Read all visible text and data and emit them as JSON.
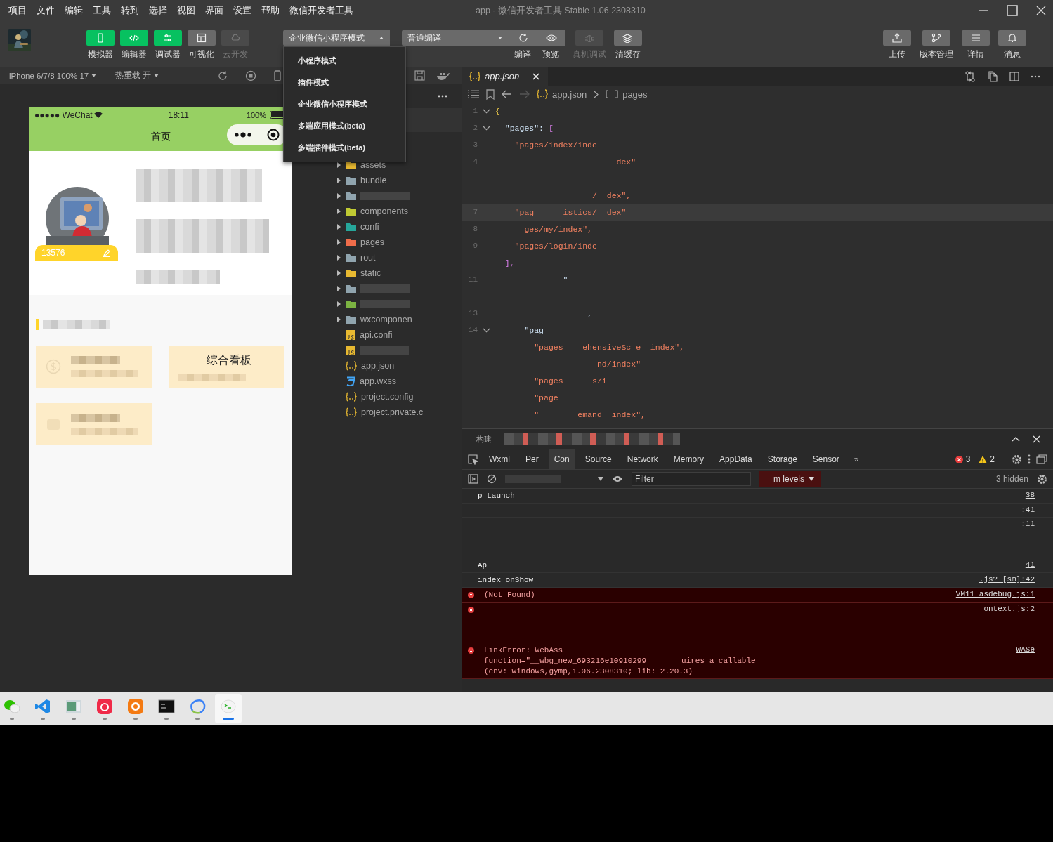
{
  "menu": [
    "项目",
    "文件",
    "编辑",
    "工具",
    "转到",
    "选择",
    "视图",
    "界面",
    "设置",
    "帮助",
    "微信开发者工具"
  ],
  "window": {
    "title": "app - 微信开发者工具 Stable 1.06.2308310"
  },
  "toolbar": {
    "view_buttons": [
      {
        "label": "模拟器",
        "on": true,
        "disabled": false
      },
      {
        "label": "编辑器",
        "on": true,
        "disabled": false
      },
      {
        "label": "调试器",
        "on": true,
        "disabled": false
      },
      {
        "label": "可视化",
        "on": false,
        "disabled": false
      },
      {
        "label": "云开发",
        "on": false,
        "disabled": true
      }
    ],
    "mode_select": {
      "value": "企业微信小程序模式",
      "expanded": true,
      "options": [
        "小程序模式",
        "插件模式",
        "企业微信小程序模式",
        "多端应用模式(beta)",
        "多端插件模式(beta)"
      ]
    },
    "compile_select": {
      "value": "普通编译"
    },
    "compile_buttons": [
      {
        "label": "编译",
        "disabled": false
      },
      {
        "label": "预览",
        "disabled": false
      },
      {
        "label": "真机调试",
        "disabled": true
      },
      {
        "label": "清缓存",
        "disabled": false
      }
    ],
    "right_buttons": [
      {
        "label": "上传"
      },
      {
        "label": "版本管理"
      },
      {
        "label": "详情"
      },
      {
        "label": "消息"
      }
    ]
  },
  "simulator": {
    "device": "iPhone 6/7/8 100% 17",
    "hot_reload": "热重载 开",
    "phone": {
      "carrier": "●●●●● WeChat",
      "time": "18:11",
      "battery": "100%",
      "nav_title": "首页",
      "badge": "13576",
      "cards": [
        {
          "kind": "coin"
        },
        {
          "kind": "board",
          "title": "综合看板"
        },
        {
          "kind": "plain"
        }
      ]
    }
  },
  "file_tree": [
    {
      "kind": "folder",
      "name": "assets",
      "color": "#e8b931",
      "expanded": false
    },
    {
      "kind": "folder",
      "name": "bundle",
      "color": "#90a4ae",
      "expanded": false
    },
    {
      "kind": "folder",
      "color": "#90a4ae",
      "expanded": false
    },
    {
      "kind": "folder",
      "name": "components",
      "color": "#c0ca33",
      "expanded": false
    },
    {
      "kind": "folder",
      "name": "confi",
      "color": "#26a69a",
      "expanded": false
    },
    {
      "kind": "folder",
      "name": "pages",
      "color": "#ef6c4a",
      "expanded": false
    },
    {
      "kind": "folder",
      "name": "rout",
      "color": "#90a4ae",
      "expanded": false
    },
    {
      "kind": "folder",
      "name": "static",
      "color": "#e8b931",
      "expanded": false
    },
    {
      "kind": "folder",
      "color": "#90a4ae",
      "expanded": false
    },
    {
      "kind": "folder",
      "color": "#7cb342",
      "expanded": false
    },
    {
      "kind": "folder",
      "name": "wxcomponen",
      "color": "#90a4ae",
      "expanded": false
    },
    {
      "kind": "js",
      "name": "api.confi"
    },
    {
      "kind": "js"
    },
    {
      "kind": "json",
      "name": "app.json"
    },
    {
      "kind": "css",
      "name": "app.wxss"
    },
    {
      "kind": "json",
      "name": "project.config"
    },
    {
      "kind": "json",
      "name": "project.private.c"
    }
  ],
  "editor": {
    "tab": {
      "label": "app.json"
    },
    "breadcrumb": [
      "app.json",
      "pages"
    ],
    "lines": [
      {
        "num": "1",
        "fold": true,
        "current": false,
        "segs": [
          {
            "t": "{",
            "kind": "brace"
          }
        ]
      },
      {
        "num": "2",
        "fold": true,
        "current": false,
        "segs": [
          {
            "t": "  \"pages\": ",
            "kind": "key"
          },
          {
            "t": "[",
            "kind": "bracket"
          }
        ]
      },
      {
        "num": "3",
        "fold": false,
        "current": false,
        "segs": [
          {
            "t": "    \"pages/index/inde",
            "kind": "str"
          }
        ]
      },
      {
        "num": "4",
        "fold": false,
        "current": false,
        "segs": [
          {
            "t": "                         dex\"",
            "kind": "str"
          }
        ]
      },
      {
        "fold": false,
        "current": false
      },
      {
        "fold": false,
        "current": false,
        "segs": [
          {
            "t": "                    /  dex\",",
            "kind": "str"
          }
        ]
      },
      {
        "num": "7",
        "fold": false,
        "current": true,
        "segs": [
          {
            "t": "    \"pag      istics/  dex\"",
            "kind": "str"
          }
        ]
      },
      {
        "num": "8",
        "fold": false,
        "current": false,
        "segs": [
          {
            "t": "      ges/my/index\",",
            "kind": "str"
          }
        ]
      },
      {
        "num": "9",
        "fold": false,
        "current": false,
        "segs": [
          {
            "t": "    \"pages/login/inde",
            "kind": "str"
          }
        ]
      },
      {
        "fold": false,
        "current": false,
        "segs": [
          {
            "t": "  ],",
            "kind": "bracket"
          }
        ]
      },
      {
        "num": "11",
        "fold": false,
        "current": false,
        "segs": [
          {
            "t": "              \"",
            "kind": "key"
          }
        ]
      },
      {
        "fold": false,
        "current": false
      },
      {
        "num": "13",
        "fold": false,
        "current": false,
        "segs": [
          {
            "t": "                   ,",
            "kind": "key"
          }
        ]
      },
      {
        "num": "14",
        "fold": true,
        "current": false,
        "segs": [
          {
            "t": "      \"pag",
            "kind": "key"
          }
        ]
      },
      {
        "fold": false,
        "current": false,
        "segs": [
          {
            "t": "        \"pages    ehensiveSc e  index\",",
            "kind": "str"
          }
        ]
      },
      {
        "fold": false,
        "current": false,
        "segs": [
          {
            "t": "                     nd/index\"",
            "kind": "str"
          }
        ]
      },
      {
        "fold": false,
        "current": false,
        "segs": [
          {
            "t": "        \"pages      s/i",
            "kind": "str"
          }
        ]
      },
      {
        "fold": false,
        "current": false,
        "segs": [
          {
            "t": "        \"page",
            "kind": "str"
          }
        ]
      },
      {
        "fold": false,
        "current": false,
        "segs": [
          {
            "t": "        \"        emand  index\",",
            "kind": "str"
          }
        ]
      }
    ]
  },
  "console": {
    "panel_tabs": [
      {
        "label": "构建",
        "selected": false
      }
    ],
    "tabs": [
      {
        "label": "Wxml",
        "selected": false
      },
      {
        "label": "Per",
        "selected": false
      },
      {
        "label": "Con",
        "selected": true
      },
      {
        "label": "Source",
        "selected": false
      },
      {
        "label": "Network",
        "selected": false
      },
      {
        "label": "Memory",
        "selected": false
      },
      {
        "label": "AppData",
        "selected": false
      },
      {
        "label": "Storage",
        "selected": false
      },
      {
        "label": "Sensor",
        "selected": false
      }
    ],
    "more": "»",
    "errors": "3",
    "warnings": "2",
    "filter_placeholder": "Filter",
    "levels": "m levels",
    "hidden": "3 hidden",
    "logs": [
      {
        "kind": "info",
        "lines": [
          [
            "p Launch"
          ]
        ],
        "source": "38"
      },
      {
        "kind": "info",
        "source": ":41"
      },
      {
        "kind": "info",
        "source": ":11",
        "tall": true
      },
      {
        "kind": "info",
        "lines": [
          [
            "Ap"
          ]
        ],
        "source": "41"
      },
      {
        "kind": "info",
        "lines": [
          [
            "index onShow"
          ]
        ],
        "source": ".js? [sm]:42"
      },
      {
        "kind": "error",
        "lines": [
          [
            "(Not Found)"
          ]
        ],
        "source": "VM11 asdebug.js:1"
      },
      {
        "kind": "error",
        "source": "ontext.js:2",
        "tall": true
      },
      {
        "kind": "error",
        "lines": [
          [
            "LinkError: WebAss"
          ],
          [
            "function=\"__wbg_new_693216e10910299",
            "uires a callable"
          ],
          [
            "(env: Windows,gymp,1.06.2308310; lib: 2.20.3)"
          ]
        ],
        "source": "WASe"
      }
    ]
  },
  "taskbar": [
    {
      "kind": "chat",
      "selected": false
    },
    {
      "kind": "code",
      "selected": false
    },
    {
      "kind": "window",
      "selected": false
    },
    {
      "kind": "music",
      "selected": false
    },
    {
      "kind": "orange",
      "selected": false
    },
    {
      "kind": "terminal",
      "selected": false
    },
    {
      "kind": "ring",
      "selected": false
    },
    {
      "kind": "devtools",
      "selected": true
    }
  ]
}
